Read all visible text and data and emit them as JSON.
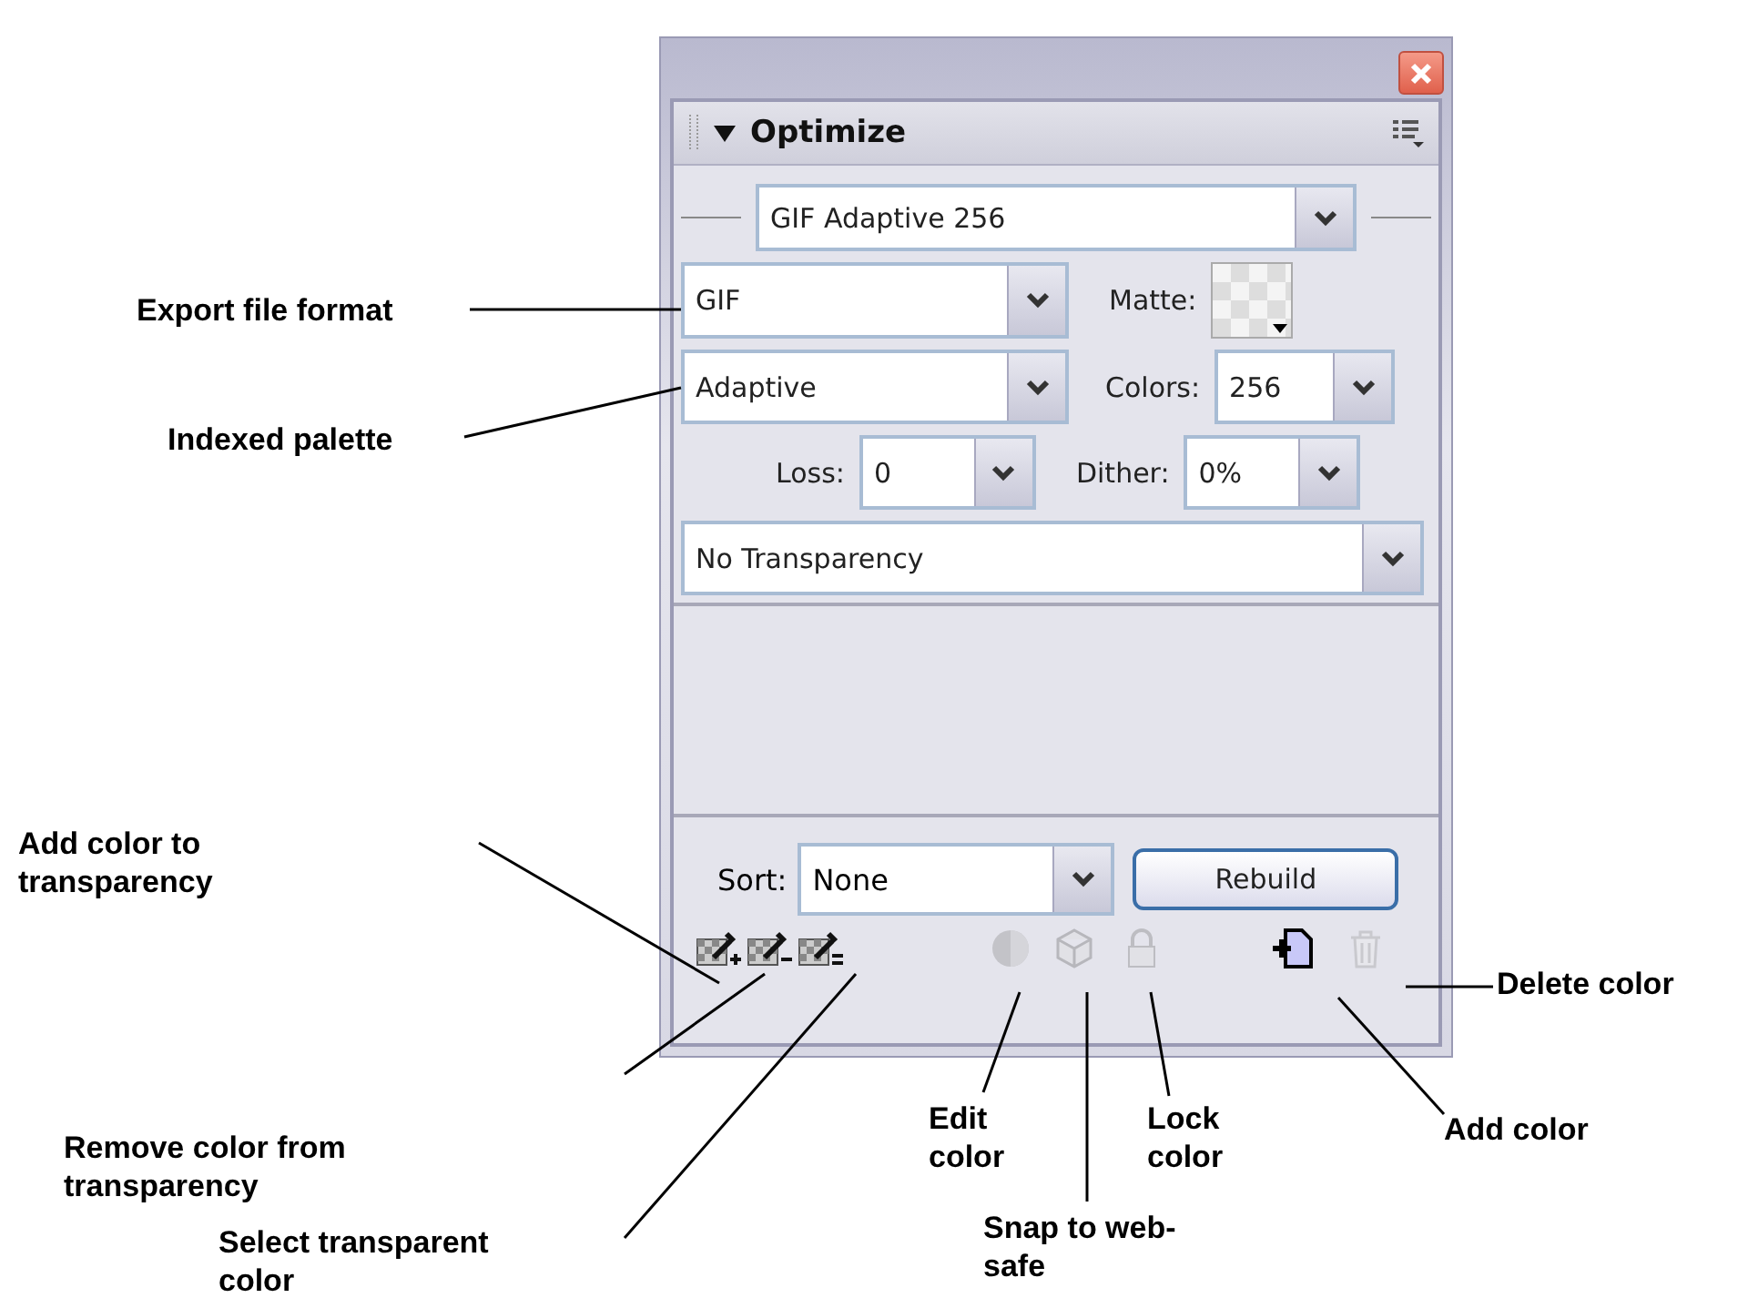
{
  "panel": {
    "title": "Optimize",
    "expanded": true,
    "preset": "GIF Adaptive 256",
    "format": "GIF",
    "matte_label": "Matte:",
    "palette": "Adaptive",
    "colors_label": "Colors:",
    "colors": "256",
    "loss_label": "Loss:",
    "loss": "0",
    "dither_label": "Dither:",
    "dither": "0%",
    "transparency": "No Transparency",
    "sort_label": "Sort:",
    "sort": "None",
    "rebuild": "Rebuild"
  },
  "tools": [
    {
      "kind": "add-transparency",
      "disabled": false
    },
    {
      "kind": "remove-transparency",
      "disabled": false
    },
    {
      "kind": "select-transparent",
      "disabled": false
    },
    {
      "kind": "edit",
      "disabled": true
    },
    {
      "kind": "snap",
      "disabled": true
    },
    {
      "kind": "lock",
      "disabled": true
    },
    {
      "kind": "add-color",
      "disabled": false
    },
    {
      "kind": "delete",
      "disabled": true
    }
  ],
  "callouts": [
    {
      "text": "Export file format"
    },
    {
      "text": "Indexed palette"
    },
    {
      "text": "Add color to transparency"
    },
    {
      "text": "Remove color from transparency"
    },
    {
      "text": "Select transparent color"
    },
    {
      "text": "Edit color"
    },
    {
      "text": "Lock color"
    },
    {
      "text": "Snap to web-safe"
    },
    {
      "text": "Add color"
    },
    {
      "text": "Delete color"
    }
  ]
}
